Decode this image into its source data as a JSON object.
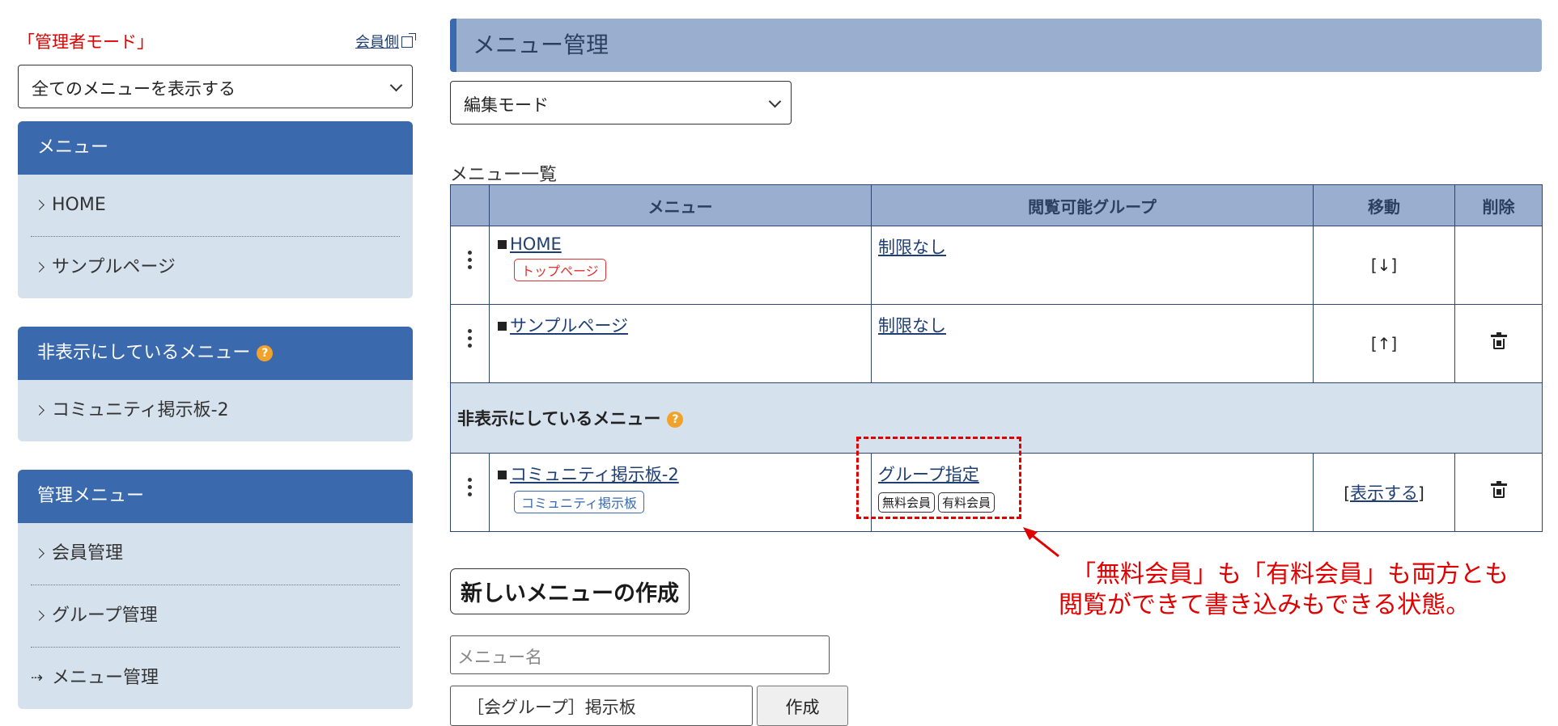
{
  "sidebar": {
    "admin_mode": "「管理者モード」",
    "member_link": "会員側",
    "filter_select": "全てのメニューを表示する",
    "menu_panel": {
      "title": "メニュー",
      "items": [
        "HOME",
        "サンプルページ"
      ]
    },
    "hidden_panel": {
      "title": "非表示にしているメニュー",
      "items": [
        "コミュニティ掲示板-2"
      ]
    },
    "admin_panel": {
      "title": "管理メニュー",
      "items": [
        "会員管理",
        "グループ管理",
        "メニュー管理"
      ]
    }
  },
  "main": {
    "title": "メニュー管理",
    "mode_select": "編集モード",
    "list_label": "メニュー一覧",
    "table": {
      "headers": [
        "",
        "メニュー",
        "閲覧可能グループ",
        "移動",
        "削除"
      ],
      "rows": [
        {
          "menu": "HOME",
          "tag": "トップページ",
          "group": "制限なし",
          "move": "[↓]"
        },
        {
          "menu": "サンプルページ",
          "group": "制限なし",
          "move": "[↑]"
        }
      ],
      "hidden_section_label": "非表示にしているメニュー",
      "hidden_rows": [
        {
          "menu": "コミュニティ掲示板-2",
          "tag": "コミュニティ掲示板",
          "group": "グループ指定",
          "group_tags": [
            "無料会員",
            "有料会員"
          ],
          "move_prefix": "[",
          "move_link": "表示する",
          "move_suffix": "]"
        }
      ]
    },
    "new_menu": {
      "title": "新しいメニューの作成",
      "name_placeholder": "メニュー名",
      "type_select": "［会グループ］掲示板",
      "create_button": "作成"
    }
  },
  "annotation": {
    "line1": "「無料会員」も「有料会員」も両方とも",
    "line2": "閲覧ができて書き込みもできる状態。",
    "color": "#e00000"
  }
}
